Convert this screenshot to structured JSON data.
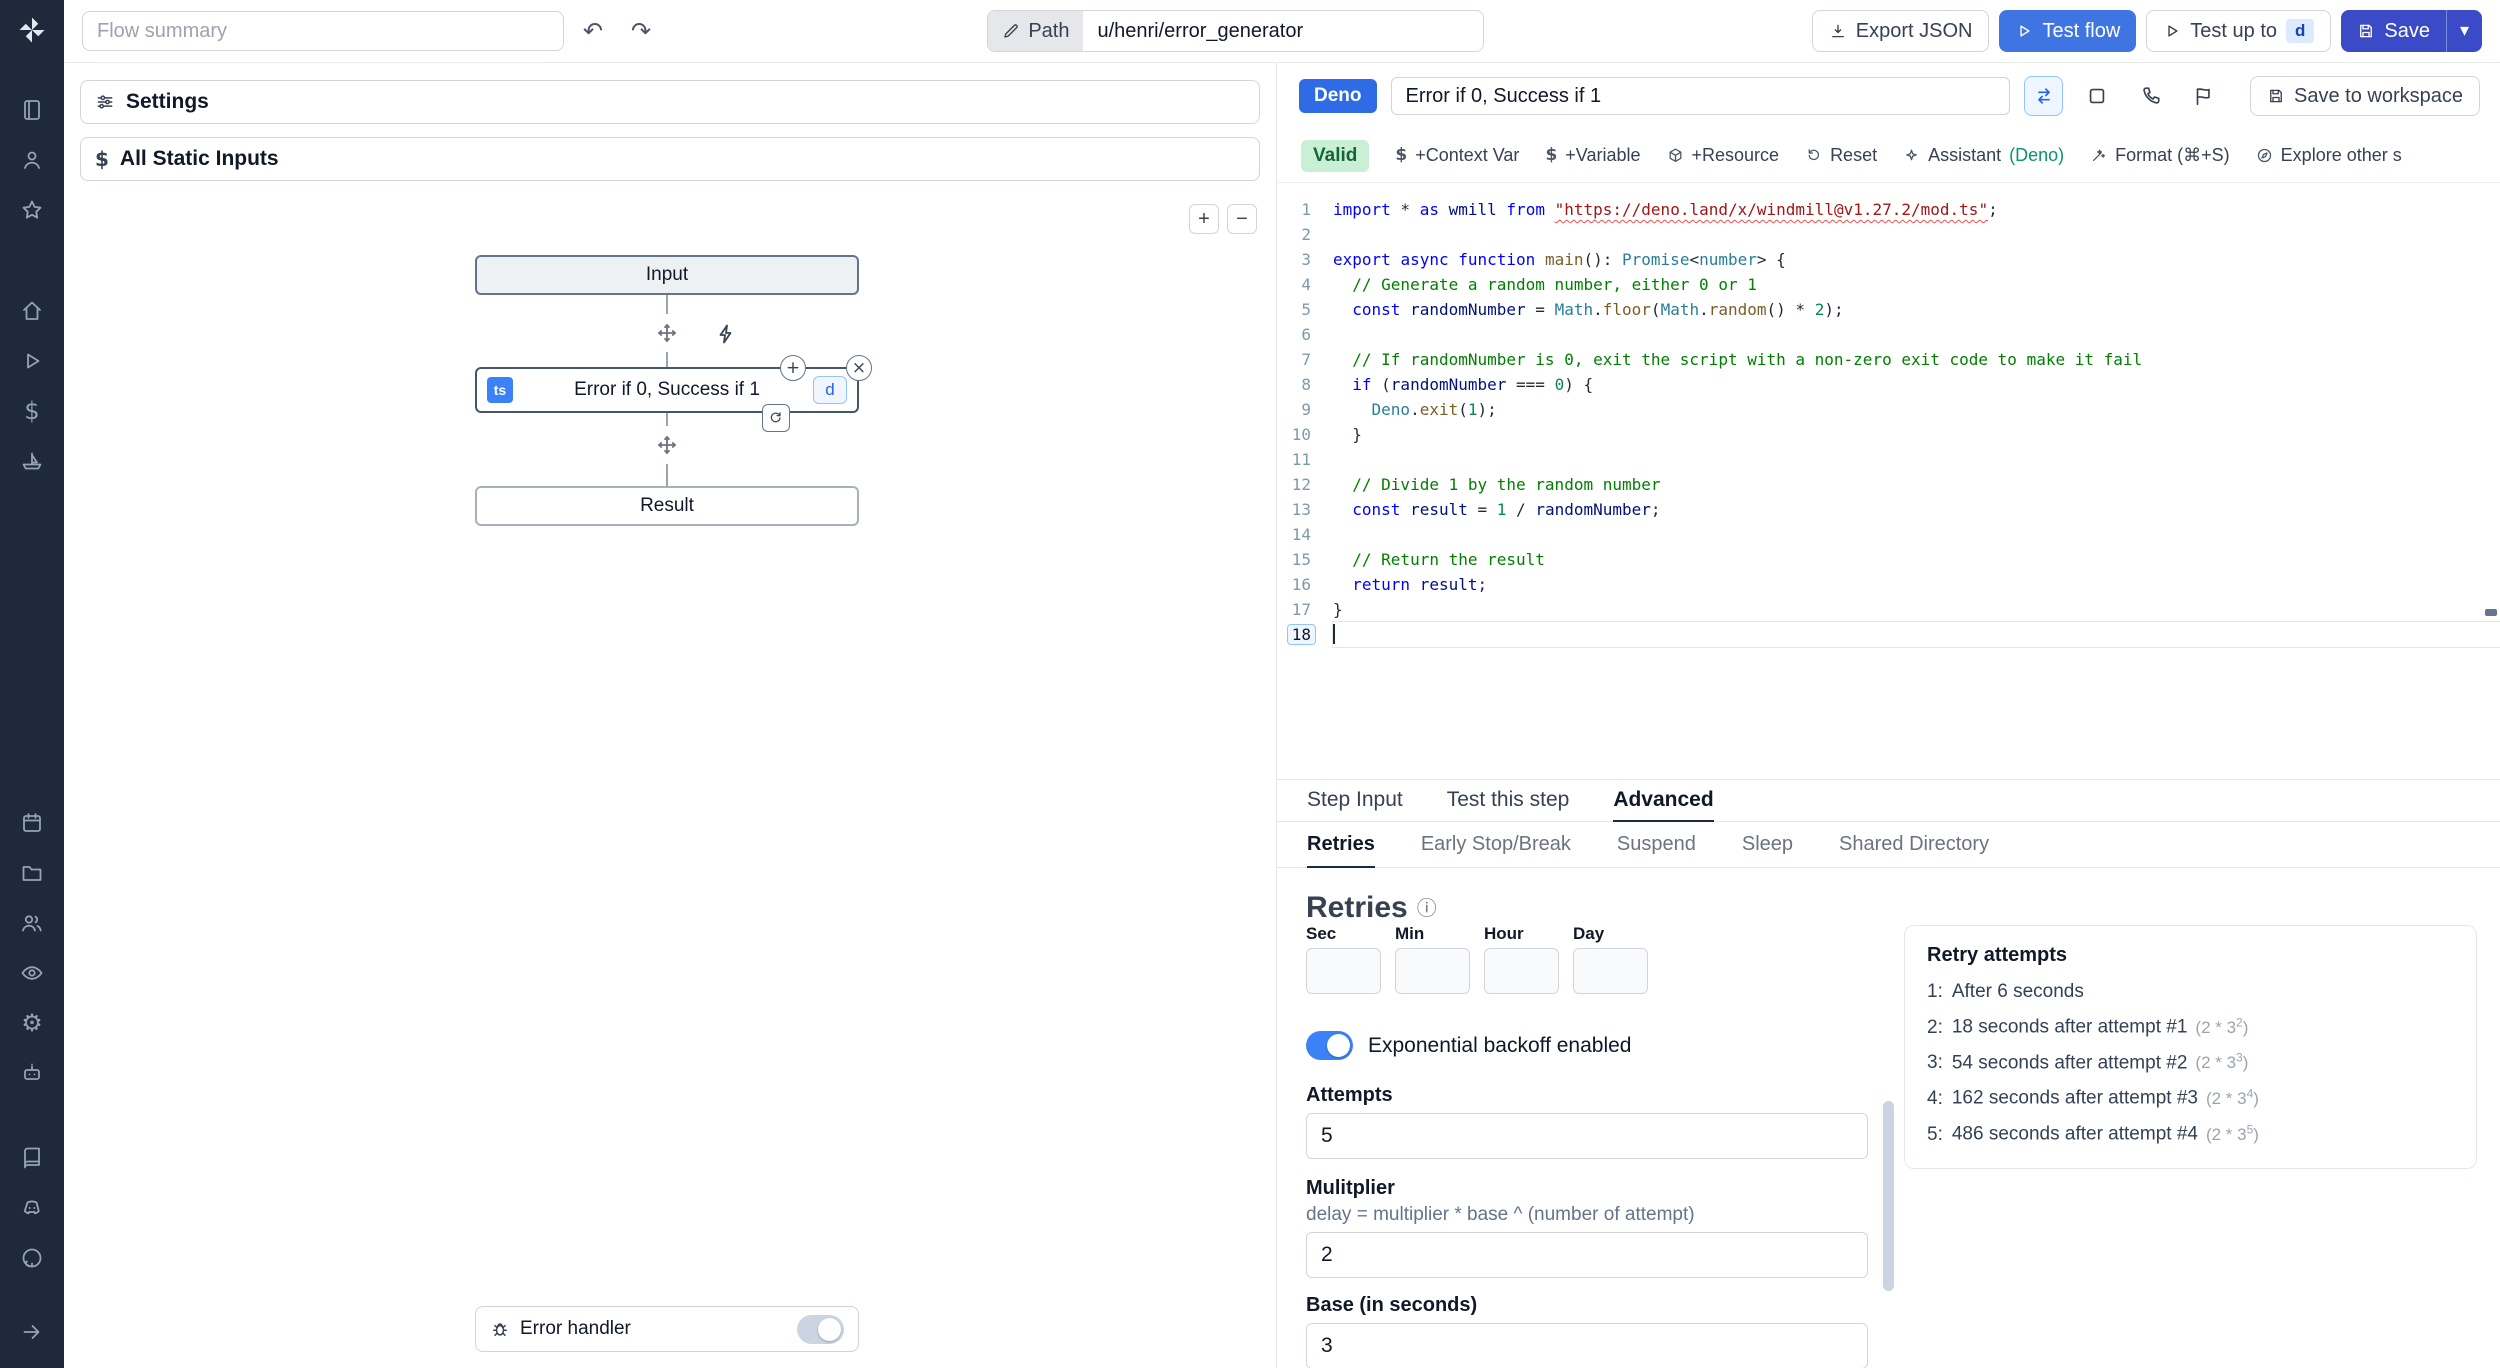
{
  "sidebar": {
    "groups": [
      [
        "journal",
        "user",
        "star"
      ],
      [
        "home",
        "play",
        "dollar",
        "boat"
      ],
      [
        "calendar",
        "folder",
        "users",
        "eye",
        "gear",
        "robot"
      ],
      [
        "book",
        "discord",
        "github"
      ]
    ]
  },
  "topbar": {
    "flow_summary_placeholder": "Flow summary",
    "path_label": "Path",
    "path_value": "u/henri/error_generator",
    "export_json_label": "Export JSON",
    "test_flow_label": "Test flow",
    "test_up_to_label": "Test up to",
    "test_up_to_key": "d",
    "save_label": "Save"
  },
  "flow_panel": {
    "settings_label": "Settings",
    "static_inputs_label": "All Static Inputs",
    "zoom_in": "+",
    "zoom_out": "−",
    "input_node_label": "Input",
    "step_node": {
      "lang_badge": "ts",
      "title": "Error if 0, Success if 1",
      "id_badge": "d"
    },
    "result_node_label": "Result",
    "error_handler_label": "Error handler"
  },
  "editor_header": {
    "lang_badge": "Deno",
    "title_value": "Error if 0, Success if 1",
    "save_to_workspace_label": "Save to workspace"
  },
  "editor_toolbar": {
    "valid_label": "Valid",
    "buttons": [
      {
        "name": "add-context-var",
        "icon": "dollar-sign",
        "label": "+Context Var"
      },
      {
        "name": "add-variable",
        "icon": "dollar-sign",
        "label": "+Variable"
      },
      {
        "name": "add-resource",
        "icon": "resource",
        "label": "+Resource"
      },
      {
        "name": "reset",
        "icon": "reset",
        "label": "Reset"
      },
      {
        "name": "assistant",
        "icon": "sparkle",
        "label": "Assistant",
        "suffix": "(Deno)"
      },
      {
        "name": "format",
        "icon": "wand",
        "label": "Format (⌘+S)"
      },
      {
        "name": "explore-scripts",
        "icon": "explore",
        "label": "Explore other s"
      }
    ]
  },
  "code": {
    "lines": [
      [
        [
          "k",
          "import"
        ],
        [
          "d",
          " * "
        ],
        [
          "k",
          "as"
        ],
        [
          "d",
          " "
        ],
        [
          "v",
          "wmill"
        ],
        [
          "d",
          " "
        ],
        [
          "k",
          "from"
        ],
        [
          "d",
          " "
        ],
        [
          "u",
          "\"https://deno.land/x/windmill@v1.27.2/mod.ts\""
        ],
        [
          "d",
          ";"
        ]
      ],
      [],
      [
        [
          "k",
          "export"
        ],
        [
          "d",
          " "
        ],
        [
          "k",
          "async"
        ],
        [
          "d",
          " "
        ],
        [
          "k",
          "function"
        ],
        [
          "d",
          " "
        ],
        [
          "f",
          "main"
        ],
        [
          "d",
          "(): "
        ],
        [
          "t",
          "Promise"
        ],
        [
          "d",
          "<"
        ],
        [
          "t",
          "number"
        ],
        [
          "d",
          "> {"
        ]
      ],
      [
        [
          "c",
          "  // Generate a random number, either 0 or 1"
        ]
      ],
      [
        [
          "d",
          "  "
        ],
        [
          "k",
          "const"
        ],
        [
          "d",
          " "
        ],
        [
          "v",
          "randomNumber"
        ],
        [
          "d",
          " = "
        ],
        [
          "t",
          "Math"
        ],
        [
          "d",
          "."
        ],
        [
          "f",
          "floor"
        ],
        [
          "d",
          "("
        ],
        [
          "t",
          "Math"
        ],
        [
          "d",
          "."
        ],
        [
          "f",
          "random"
        ],
        [
          "d",
          "() * "
        ],
        [
          "n",
          "2"
        ],
        [
          "d",
          ");"
        ]
      ],
      [],
      [
        [
          "c",
          "  // If randomNumber is 0, exit the script with a non-zero exit code to make it fail"
        ]
      ],
      [
        [
          "d",
          "  "
        ],
        [
          "k",
          "if"
        ],
        [
          "d",
          " ("
        ],
        [
          "v",
          "randomNumber"
        ],
        [
          "d",
          " === "
        ],
        [
          "n",
          "0"
        ],
        [
          "d",
          ") {"
        ]
      ],
      [
        [
          "d",
          "    "
        ],
        [
          "t",
          "Deno"
        ],
        [
          "d",
          "."
        ],
        [
          "f",
          "exit"
        ],
        [
          "d",
          "("
        ],
        [
          "n",
          "1"
        ],
        [
          "d",
          ");"
        ]
      ],
      [
        [
          "d",
          "  }"
        ]
      ],
      [],
      [
        [
          "c",
          "  // Divide 1 by the random number"
        ]
      ],
      [
        [
          "d",
          "  "
        ],
        [
          "k",
          "const"
        ],
        [
          "d",
          " "
        ],
        [
          "v",
          "result"
        ],
        [
          "d",
          " = "
        ],
        [
          "n",
          "1"
        ],
        [
          "d",
          " / "
        ],
        [
          "v",
          "randomNumber"
        ],
        [
          "d",
          ";"
        ]
      ],
      [],
      [
        [
          "c",
          "  // Return the result"
        ]
      ],
      [
        [
          "d",
          "  "
        ],
        [
          "k",
          "return"
        ],
        [
          "d",
          " "
        ],
        [
          "v",
          "result"
        ],
        [
          "d",
          ";"
        ]
      ],
      [
        [
          "d",
          "}"
        ]
      ],
      []
    ]
  },
  "bottom": {
    "tabs": [
      "Step Input",
      "Test this step",
      "Advanced"
    ],
    "active_tab": 2,
    "subtabs": [
      "Retries",
      "Early Stop/Break",
      "Suspend",
      "Sleep",
      "Shared Directory"
    ],
    "active_subtab": 0
  },
  "retries": {
    "heading": "Retries",
    "time_units": [
      "Sec",
      "Min",
      "Hour",
      "Day"
    ],
    "backoff_label": "Exponential backoff enabled",
    "attempts_label": "Attempts",
    "attempts_value": "5",
    "multiplier_label": "Mulitplier",
    "multiplier_help": "delay = multiplier * base ^ (number of attempt)",
    "multiplier_value": "2",
    "base_label": "Base (in seconds)",
    "base_value": "3",
    "panel_title": "Retry attempts",
    "attempts_list": [
      {
        "n": "1:",
        "text": "After 6 seconds"
      },
      {
        "n": "2:",
        "text": "18 seconds after attempt #1",
        "f": "2 * 3",
        "e": "2"
      },
      {
        "n": "3:",
        "text": "54 seconds after attempt #2",
        "f": "2 * 3",
        "e": "3"
      },
      {
        "n": "4:",
        "text": "162 seconds after attempt #3",
        "f": "2 * 3",
        "e": "4"
      },
      {
        "n": "5:",
        "text": "486 seconds after attempt #4",
        "f": "2 * 3",
        "e": "5"
      }
    ]
  },
  "colors": {
    "sidebar_bg": "#1e293b",
    "primary_blue": "#3f74e3",
    "save_blue": "#3b4bc8",
    "deno_badge_blue": "#2f6be4",
    "valid_green_bg": "#c9f0d4",
    "valid_green_text": "#166534",
    "toggle_on_blue": "#3b82f6"
  }
}
